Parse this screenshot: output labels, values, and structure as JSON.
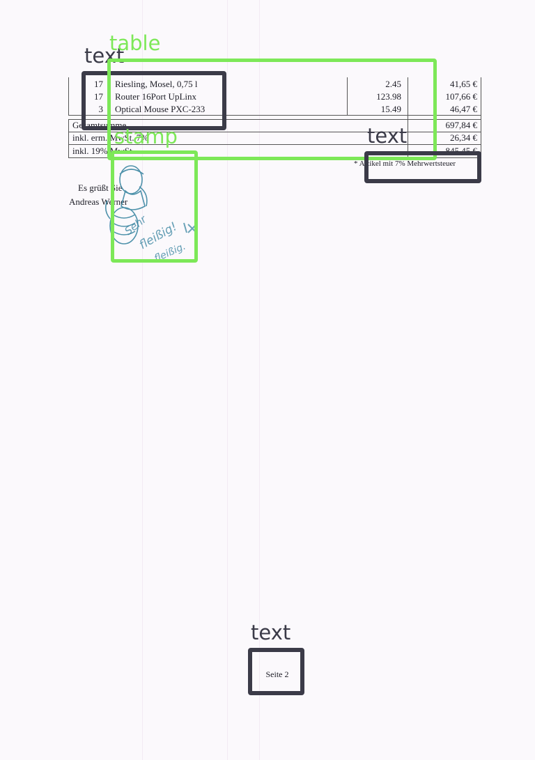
{
  "invoice": {
    "items": [
      {
        "qty": "17",
        "desc": "Riesling, Mosel, 0,75 l",
        "price": "2.45",
        "total": "41,65 €"
      },
      {
        "qty": "17",
        "desc": "Router 16Port UpLinx",
        "price": "123.98",
        "total": "107,66 €"
      },
      {
        "qty": "3",
        "desc": "Optical Mouse PXC-233",
        "price": "15.49",
        "total": "46,47 €"
      }
    ],
    "summary": [
      {
        "label": "Gesamtsumme",
        "value": "697,84 €"
      },
      {
        "label": "inkl. erm. MwSt. 7%",
        "value": "26,34 €"
      },
      {
        "label": "inkl. 19% MwSt.",
        "value": "845,45 €"
      }
    ],
    "footnote": "* Artikel mit 7% Mehrwertsteuer"
  },
  "closing": {
    "greeting": "Es grüßt Sie",
    "signature": "Andreas Werner"
  },
  "stamp": {
    "text_lines": [
      "Sehr",
      "fleißig!",
      "fleißig."
    ],
    "color": "#2f7f9c"
  },
  "page_number": "Seite 2",
  "annotations": {
    "text_label": "text",
    "table_label": "table",
    "stamp_label": "stamp",
    "dark_color": "#3b3b48",
    "green_color": "#7de858"
  }
}
